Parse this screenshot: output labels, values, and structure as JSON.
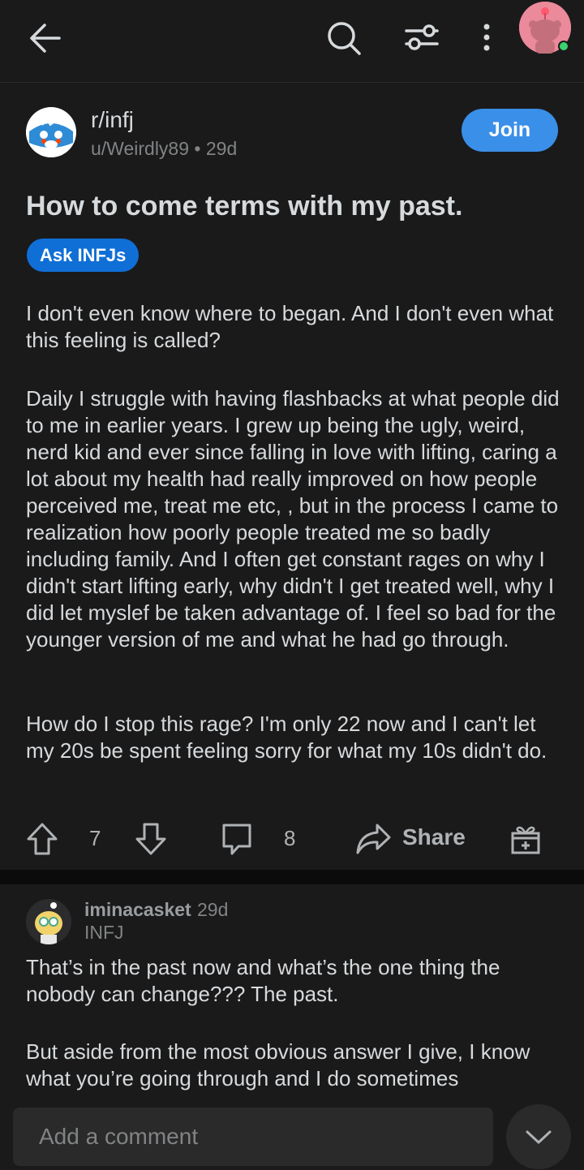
{
  "topbar": {
    "icons": [
      "back-arrow-icon",
      "search-icon",
      "sort-filter-icon",
      "more-vertical-icon",
      "user-avatar"
    ],
    "online_color": "#3bd16f"
  },
  "post": {
    "subreddit": "r/infj",
    "author": "u/Weirdly89",
    "separator": "•",
    "age": "29d",
    "join_label": "Join",
    "title": "How to come terms with my past.",
    "flair": "Ask INFJs",
    "paragraphs": [
      "I don't even know where to began.  And I don't even what this feeling is called?",
      "Daily I struggle with having flashbacks at what people did to me in earlier years. I grew up being the ugly, weird, nerd kid and ever since falling in love with lifting, caring a lot about my health had really improved on how people perceived me, treat me etc, , but in the process I came to realization how poorly people treated me so badly including family. And I often get constant rages on why I didn't start lifting early, why didn't I get treated well, why I did let myslef be taken advantage of. I feel so bad for the younger version of me and what he had go through.",
      "How do I stop this rage? I'm only 22 now and I can't let my 20s be spent feeling sorry for what my 10s didn't do."
    ],
    "votes": "7",
    "comments": "8",
    "share_label": "Share"
  },
  "comment": {
    "username": "iminacasket",
    "age": "29d",
    "flair": "INFJ",
    "paragraphs": [
      "That’s in the past now and what’s the one thing the nobody can change??? The past.",
      "But aside from the most obvious answer I give, I know what you’re going through and I do sometimes"
    ]
  },
  "bottom": {
    "placeholder": "Add a comment"
  },
  "colors": {
    "background": "#1a1a1b",
    "join": "#3a8fe8",
    "flair": "#0f6fd6"
  }
}
